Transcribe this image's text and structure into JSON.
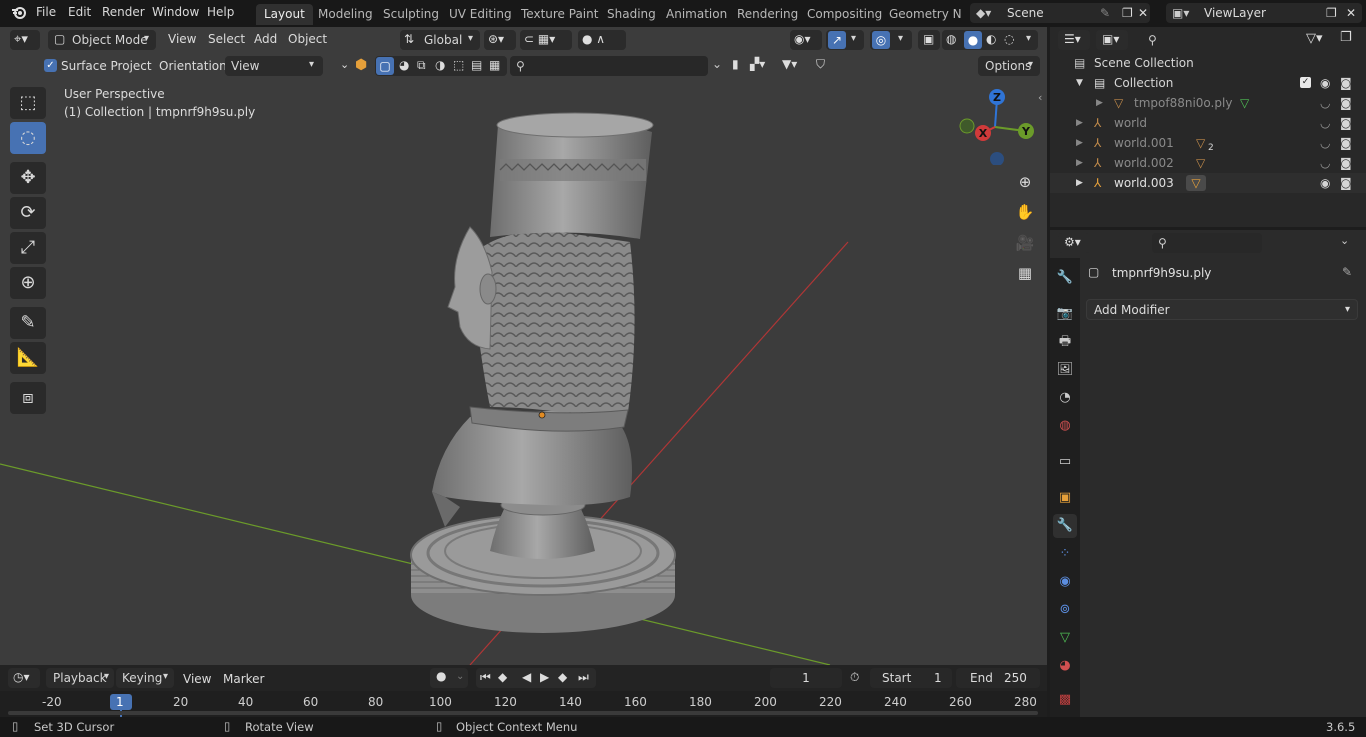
{
  "topbar": {
    "menus": [
      "File",
      "Edit",
      "Render",
      "Window",
      "Help"
    ],
    "workspaces": [
      "Layout",
      "Modeling",
      "Sculpting",
      "UV Editing",
      "Texture Paint",
      "Shading",
      "Animation",
      "Rendering",
      "Compositing",
      "Geometry Noc"
    ],
    "active_workspace": "Layout",
    "scene": "Scene",
    "view_layer": "ViewLayer"
  },
  "viewport_header": {
    "mode": "Object Mode",
    "menus": [
      "View",
      "Select",
      "Add",
      "Object"
    ],
    "transform_orientation": "Global",
    "surface_project_label": "Surface Project",
    "surface_project_checked": true,
    "orientation_label": "Orientation:",
    "orientation_value": "View",
    "options_label": "Options"
  },
  "viewport": {
    "perspective_label": "User Perspective",
    "collection_label": "(1) Collection | tmpnrf9h9su.ply",
    "gizmo": {
      "z": "Z",
      "x": "X",
      "y": "Y"
    }
  },
  "outliner": {
    "root": "Scene Collection",
    "collection": "Collection",
    "items": [
      {
        "name": "tmpof88ni0o.ply",
        "dimmed": true
      },
      {
        "name": "world",
        "dimmed": true
      },
      {
        "name": "world.001",
        "dimmed": true,
        "badge": "2"
      },
      {
        "name": "world.002",
        "dimmed": true
      },
      {
        "name": "world.003",
        "dimmed": false
      }
    ]
  },
  "properties": {
    "object_name": "tmpnrf9h9su.ply",
    "add_modifier_label": "Add Modifier"
  },
  "timeline": {
    "menus": [
      "Playback",
      "Keying",
      "View",
      "Marker"
    ],
    "current_frame": "1",
    "start_label": "Start",
    "start_value": "1",
    "end_label": "End",
    "end_value": "250",
    "ruler": [
      "-20",
      "1",
      "20",
      "40",
      "60",
      "80",
      "100",
      "120",
      "140",
      "160",
      "180",
      "200",
      "220",
      "240",
      "260",
      "280"
    ]
  },
  "statusbar": {
    "left": "Set 3D Cursor",
    "middle": "Rotate View",
    "right": "Object Context Menu",
    "version": "3.6.5"
  },
  "colors": {
    "accent": "#4772b3",
    "viewport_bg": "#3c3c3c",
    "x_axis": "#d03a3a",
    "y_axis": "#6b9b2a",
    "z_axis": "#2f74d6",
    "object_origin": "#e28b22"
  }
}
